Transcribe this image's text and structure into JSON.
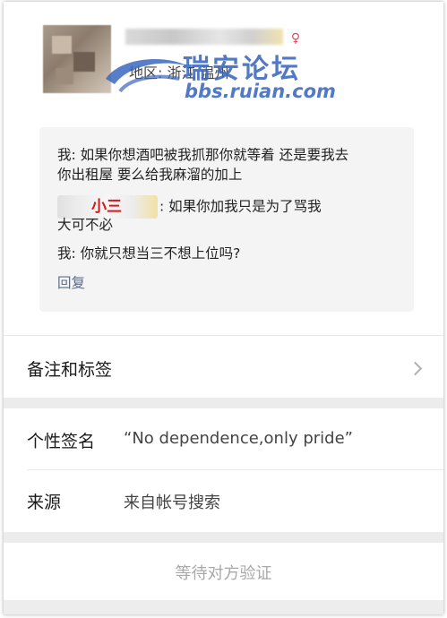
{
  "profile": {
    "region": "地区: 浙江 温州",
    "gender_icon": "female-icon"
  },
  "watermark": {
    "cn": "瑞安论坛",
    "en": "bbs.ruian.com"
  },
  "messages": {
    "line1": "我: 如果你想酒吧被我抓那你就等着  还是要我去",
    "line2": "你出租屋 要么给我麻溜的加上",
    "sender_tag": "小三",
    "line3_rest": ": 如果你加我只是为了骂我",
    "line4": "大可不必",
    "line5": "我: 你就只想当三不想上位吗?",
    "reply_label": "回复"
  },
  "notes_row": {
    "label": "备注和标签"
  },
  "signature_row": {
    "label": "个性签名",
    "value": "“No dependence,only pride”"
  },
  "source_row": {
    "label": "来源",
    "value": "来自帐号搜索"
  },
  "pending": {
    "label": "等待对方验证"
  },
  "colors": {
    "link": "#576b95",
    "tag_red": "#d41a1a",
    "female": "#e0465f",
    "watermark_blue": "#3a67be"
  }
}
